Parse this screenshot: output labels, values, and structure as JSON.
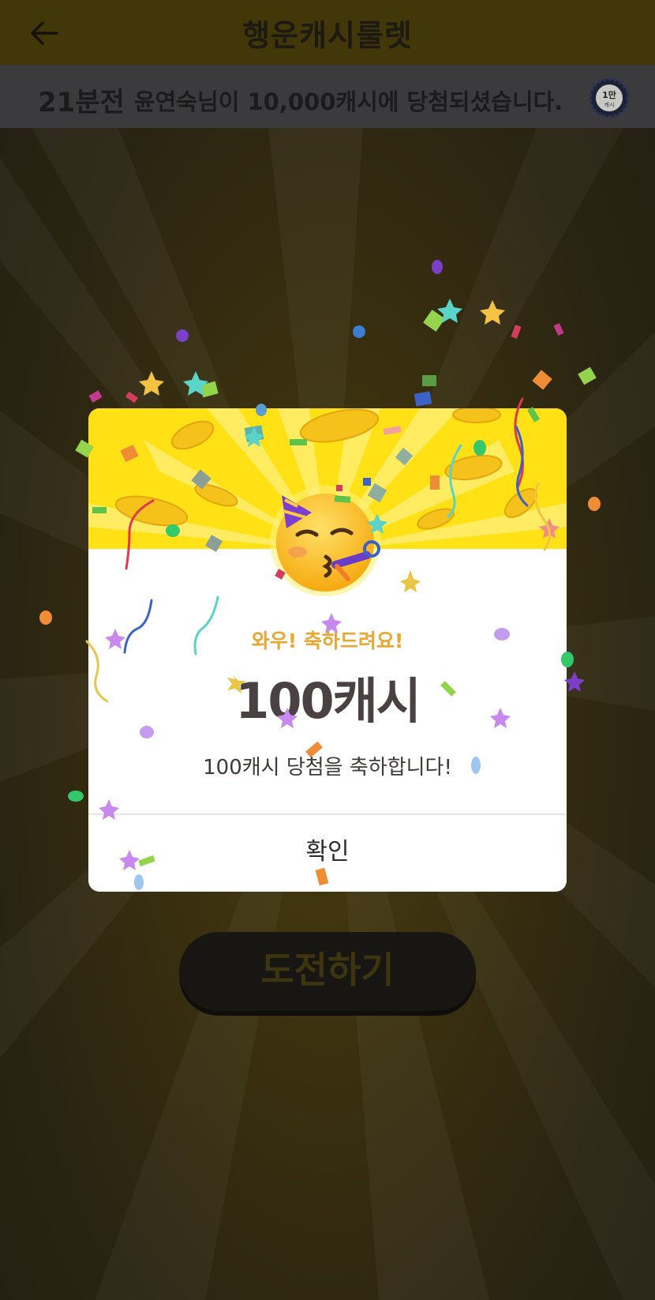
{
  "header": {
    "title": "행운캐시룰렛"
  },
  "ticker": {
    "time_ago": "21분전",
    "message": "윤연숙님이 10,000캐시에 당첨되셨습니다.",
    "badge_text": "1만",
    "badge_subtext": "캐시"
  },
  "modal": {
    "greeting": "와우! 축하드려요!",
    "amount": "100캐시",
    "subtext": "100캐시 당첨을 축하합니다!",
    "confirm_label": "확인"
  },
  "challenge_button": {
    "label": "도전하기"
  },
  "colors": {
    "modal_top": "#ffe116",
    "greeting": "#e9a730",
    "amount": "#4a4143"
  },
  "icons": {
    "back": "arrow-left-icon",
    "badge": "coin-badge-icon",
    "emoji": "partying-face-icon"
  }
}
